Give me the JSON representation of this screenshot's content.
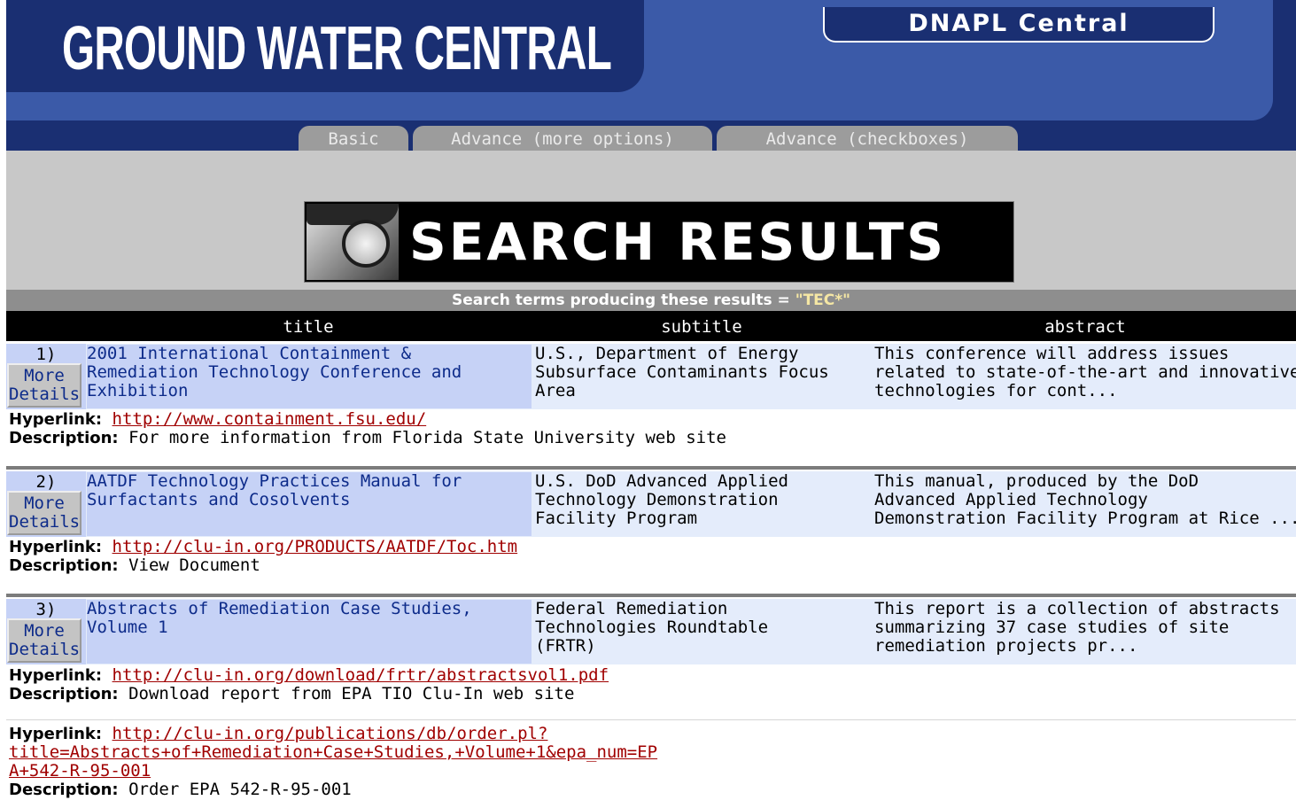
{
  "header": {
    "brand": "GROUND WATER CENTRAL",
    "dnapl": "DNAPL Central",
    "tabs": [
      "Basic",
      "Advance (more options)",
      "Advance (checkboxes)"
    ]
  },
  "banner": {
    "title": "SEARCH RESULTS"
  },
  "search": {
    "prefix": "Search terms producing these results = ",
    "term": "\"TEC*\""
  },
  "columns": [
    "title",
    "subtitle",
    "abstract"
  ],
  "details_label": "More\nDetails",
  "labels": {
    "hyperlink": "Hyperlink:",
    "description": "Description:"
  },
  "results": [
    {
      "num": "1)",
      "title": "2001 International Containment &\nRemediation Technology Conference and\nExhibition",
      "subtitle": "U.S., Department of Energy\nSubsurface Contaminants Focus\nArea",
      "abstract": "This conference will address issues\nrelated to state-of-the-art and innovative\ntechnologies for cont...",
      "links": [
        {
          "url": "http://www.containment.fsu.edu/",
          "description": "For more information from Florida State University web site"
        }
      ]
    },
    {
      "num": "2)",
      "title": "AATDF Technology Practices Manual for\nSurfactants and Cosolvents",
      "subtitle": "U.S. DoD Advanced Applied\nTechnology Demonstration\nFacility Program",
      "abstract": "This manual, produced by the DoD\nAdvanced Applied Technology\nDemonstration Facility Program at Rice ...",
      "links": [
        {
          "url": "http://clu-in.org/PRODUCTS/AATDF/Toc.htm",
          "description": "View Document"
        }
      ]
    },
    {
      "num": "3)",
      "title": "Abstracts of Remediation Case Studies,\nVolume 1",
      "subtitle": "Federal Remediation\nTechnologies Roundtable\n(FRTR)",
      "abstract": "This report is a collection of abstracts\nsummarizing 37 case studies of site\nremediation projects pr...",
      "links": [
        {
          "url": "http://clu-in.org/download/frtr/abstractsvol1.pdf",
          "description": "Download report from EPA TIO Clu-In web site"
        },
        {
          "url": "http://clu-in.org/publications/db/order.pl?\ntitle=Abstracts+of+Remediation+Case+Studies,+Volume+1&epa_num=EP\nA+542-R-95-001",
          "description": "Order EPA 542-R-95-001"
        }
      ]
    }
  ]
}
